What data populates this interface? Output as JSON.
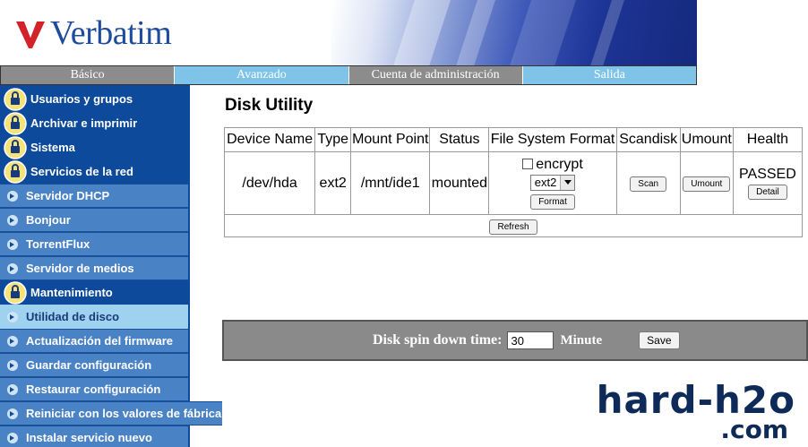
{
  "header": {
    "brand": "Verbatim",
    "watermark_line1": "hard-h2o",
    "watermark_line2": ".com"
  },
  "topnav": [
    {
      "label": "Básico"
    },
    {
      "label": "Avanzado"
    },
    {
      "label": "Cuenta de administración"
    },
    {
      "label": "Salida"
    }
  ],
  "sidebar": {
    "items": [
      {
        "label": "Usuarios y grupos"
      },
      {
        "label": "Archivar e imprimir"
      },
      {
        "label": "Sistema"
      },
      {
        "label": "Servicios de la red"
      },
      {
        "label": "Servidor DHCP"
      },
      {
        "label": "Bonjour"
      },
      {
        "label": "TorrentFlux"
      },
      {
        "label": "Servidor de medios"
      },
      {
        "label": "Mantenimiento"
      },
      {
        "label": "Utilidad de disco"
      },
      {
        "label": "Actualización del firmware"
      },
      {
        "label": "Guardar configuración"
      },
      {
        "label": "Restaurar configuración"
      },
      {
        "label": "Reiniciar con los valores de fábrica"
      },
      {
        "label": "Instalar servicio nuevo"
      }
    ]
  },
  "main": {
    "title": "Disk Utility",
    "columns": [
      "Device Name",
      "Type",
      "Mount Point",
      "Status",
      "File System Format",
      "Scandisk",
      "Umount",
      "Health"
    ],
    "row": {
      "device": "/dev/hda",
      "type": "ext2",
      "mount_point": "/mnt/ide1",
      "status": "mounted",
      "encrypt_label": "encrypt",
      "encrypt_checked": false,
      "fs_selected": "ext2",
      "format_button": "Format",
      "scan_button": "Scan",
      "umount_button": "Umount",
      "health": "PASSED",
      "detail_button": "Detail"
    },
    "refresh_button": "Refresh"
  },
  "spin": {
    "label": "Disk spin down time:",
    "value": "30",
    "unit": "Minute",
    "save_button": "Save"
  }
}
